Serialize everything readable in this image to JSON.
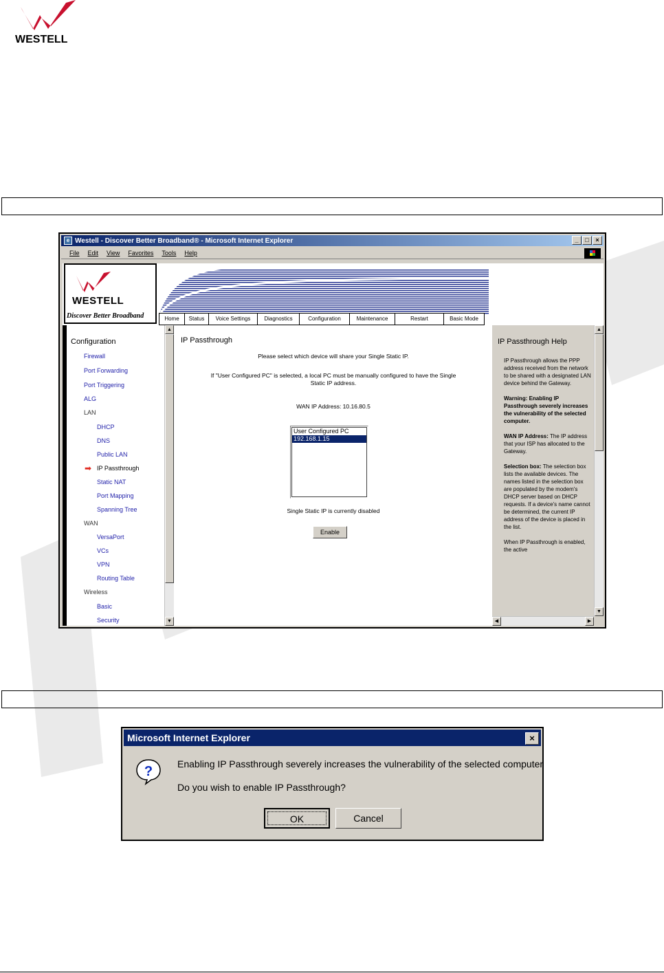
{
  "doc": {
    "logo_text": "WESTELL"
  },
  "browser": {
    "title": "Westell - Discover Better Broadband® - Microsoft Internet Explorer",
    "menu": [
      "File",
      "Edit",
      "View",
      "Favorites",
      "Tools",
      "Help"
    ],
    "controls": {
      "minimize": "_",
      "maximize": "□",
      "close": "×"
    }
  },
  "header": {
    "wordmark": "WESTELL",
    "tagline": "Discover Better Broadband",
    "nav": [
      "Home",
      "Status",
      "Voice Settings",
      "Diagnostics",
      "Configuration",
      "Maintenance",
      "Restart",
      "Basic Mode"
    ]
  },
  "sidebar": {
    "heading": "Configuration",
    "items": [
      {
        "label": "Firewall"
      },
      {
        "label": "Port Forwarding"
      },
      {
        "label": "Port Triggering"
      },
      {
        "label": "ALG"
      },
      {
        "label": "LAN"
      },
      {
        "label": "DHCP"
      },
      {
        "label": "DNS"
      },
      {
        "label": "Public LAN"
      },
      {
        "label": "IP Passthrough"
      },
      {
        "label": "Static NAT"
      },
      {
        "label": "Port Mapping"
      },
      {
        "label": "Spanning Tree"
      },
      {
        "label": "WAN"
      },
      {
        "label": "VersaPort"
      },
      {
        "label": "VCs"
      },
      {
        "label": "VPN"
      },
      {
        "label": "Routing Table"
      },
      {
        "label": "Wireless"
      },
      {
        "label": "Basic"
      },
      {
        "label": "Security"
      }
    ]
  },
  "main": {
    "title": "IP Passthrough",
    "intro": "Please select which device will share your Single Static IP.",
    "note_line1": "If \"User Configured PC\" is selected, a local PC must be manually configured to have the Single",
    "note_line2": "Static IP address.",
    "wan_ip": "WAN IP Address: 10.16.80.5",
    "options": [
      "User Configured PC",
      "192.168.1.15"
    ],
    "status": "Single Static IP is currently disabled",
    "enable_label": "Enable"
  },
  "help": {
    "title": "IP Passthrough Help",
    "p1": "IP Passthrough allows the PPP address received from the network to be shared with a designated LAN device behind the Gateway.",
    "p2": "Warning: Enabling IP Passthrough severely increases the vulnerability of the selected computer.",
    "p3_label": "WAN IP Address:",
    "p3": " The IP address that your ISP has allocated to the Gateway.",
    "p4_label": "Selection box:",
    "p4": " The selection box lists the available devices. The names listed in the selection box are populated by the modem's DHCP server based on DHCP requests. If a device's name cannot be determined, the current IP address of the device is placed in the list.",
    "p5": "When IP Passthrough is enabled, the active"
  },
  "dialog": {
    "title": "Microsoft Internet Explorer",
    "close": "×",
    "message1": "Enabling IP Passthrough severely increases the vulnerability of the selected computer",
    "message2": "Do you wish to enable IP Passthrough?",
    "ok_label": "OK",
    "cancel_label": "Cancel"
  }
}
